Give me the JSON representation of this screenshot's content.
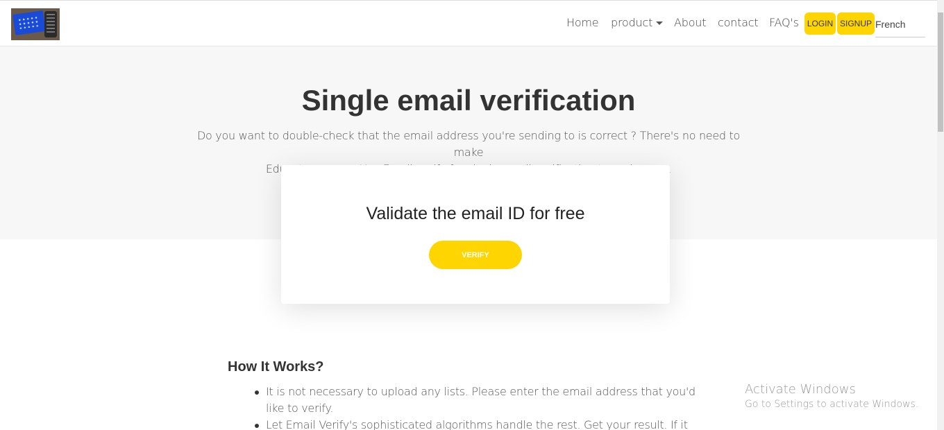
{
  "header": {
    "logo_name": "site-logo",
    "nav": {
      "home": "Home",
      "product": "product",
      "about": "About",
      "contact": "contact",
      "faq": "FAQ's"
    },
    "login_label": "LOGIN",
    "signup_label": "SIGNUP",
    "language": "French"
  },
  "hero": {
    "title": "Single email verification",
    "subtitle_line1": "Do you want to double-check that the email address you're sending to is correct ? There's no need to make",
    "subtitle_line2": "Educate guesses.Use Email verify for single email verification to make sure."
  },
  "card": {
    "title": "Validate the email ID for free",
    "verify_label": "VERIFY"
  },
  "how_it_works": {
    "title": "How It Works?",
    "items": [
      "It is not necessary to upload any lists. Please enter the email address that you'd like to verify.",
      "Let Email Verify's sophisticated algorithms handle the rest. Get your result. If it says"
    ]
  },
  "watermark": {
    "title": "Activate Windows",
    "subtitle": "Go to Settings to activate Windows."
  },
  "colors": {
    "accent_yellow": "#ffd500",
    "hero_bg": "#f7f7f7"
  }
}
